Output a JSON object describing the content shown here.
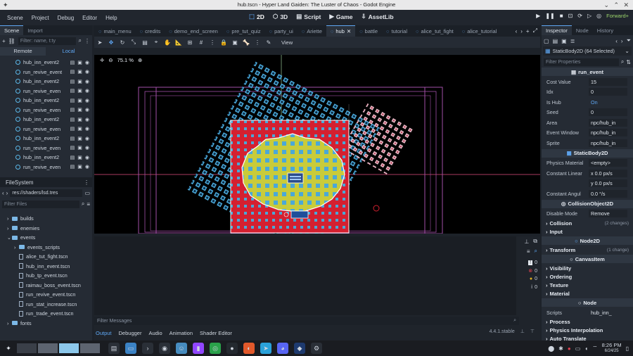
{
  "window": {
    "title": "hub.tscn - Hyper Land Gaiden: The Luster of Chaos - Godot Engine"
  },
  "menus": [
    "Scene",
    "Project",
    "Debug",
    "Editor",
    "Help"
  ],
  "workspaces": [
    {
      "label": "2D",
      "icon": "2d-icon",
      "active": true
    },
    {
      "label": "3D",
      "icon": "3d-icon"
    },
    {
      "label": "Script",
      "icon": "script-icon"
    },
    {
      "label": "Game",
      "icon": "game-icon"
    },
    {
      "label": "AssetLib",
      "icon": "assetlib-icon"
    }
  ],
  "renderer": "Forward+",
  "left_dock": {
    "tabs": [
      "Scene",
      "Import"
    ],
    "filter_placeholder": "Filter: name, t:ty",
    "remote_label": "Remote",
    "local_label": "Local",
    "nodes": [
      "hub_inn_event2",
      "run_revive_event",
      "hub_inn_event2",
      "run_revive_even",
      "hub_inn_event2",
      "run_revive_even",
      "hub_inn_event2",
      "run_revive_even",
      "hub_inn_event2",
      "run_revive_even",
      "hub_inn_event2",
      "run_revive_even"
    ]
  },
  "filesystem": {
    "title": "FileSystem",
    "path": "res://shaders/lsd.tres",
    "filter_placeholder": "Filter Files",
    "entries": [
      {
        "name": "builds",
        "type": "folder",
        "indent": 1
      },
      {
        "name": "enemies",
        "type": "folder",
        "indent": 1
      },
      {
        "name": "events",
        "type": "folder",
        "indent": 1,
        "open": true
      },
      {
        "name": "events_scripts",
        "type": "folder",
        "indent": 2
      },
      {
        "name": "alice_tut_fight.tscn",
        "type": "file",
        "indent": 2
      },
      {
        "name": "hub_inn_event.tscn",
        "type": "file",
        "indent": 2
      },
      {
        "name": "hub_tp_event.tscn",
        "type": "file",
        "indent": 2
      },
      {
        "name": "raimau_boss_event.tscn",
        "type": "file",
        "indent": 2
      },
      {
        "name": "run_revive_event.tscn",
        "type": "file",
        "indent": 2
      },
      {
        "name": "run_stat_increase.tscn",
        "type": "file",
        "indent": 2
      },
      {
        "name": "run_trade_event.tscn",
        "type": "file",
        "indent": 2
      },
      {
        "name": "fonts",
        "type": "folder",
        "indent": 1
      }
    ]
  },
  "scene_tabs": [
    "main_menu",
    "credits",
    "demo_end_screen",
    "pre_tut_quiz",
    "party_ui",
    "Ariette",
    "hub",
    "battle",
    "tutorial",
    "alice_tut_fight",
    "alice_tutorial"
  ],
  "active_scene_tab": "hub",
  "toolbar": {
    "view_label": "View"
  },
  "viewport": {
    "zoom": "75.1 %"
  },
  "bottom_panel": {
    "filter_placeholder": "Filter Messages",
    "tabs": [
      "Output",
      "Debugger",
      "Audio",
      "Animation",
      "Shader Editor"
    ],
    "version": "4.4.1.stable",
    "counts": [
      "0",
      "0",
      "0",
      "0"
    ]
  },
  "inspector": {
    "tabs": [
      "Inspector",
      "Node",
      "History"
    ],
    "object": "StaticBody2D (64 Selected)",
    "filter_placeholder": "Filter Properties",
    "script_section": "run_event",
    "props": [
      {
        "k": "Cost Value",
        "v": "15"
      },
      {
        "k": "Idx",
        "v": "0"
      },
      {
        "k": "Is Hub",
        "v": "On"
      },
      {
        "k": "Seed",
        "v": "0"
      },
      {
        "k": "Area",
        "v": "npc/hub_in"
      },
      {
        "k": "Event Window",
        "v": "npc/hub_in"
      },
      {
        "k": "Sprite",
        "v": "npc/hub_in"
      }
    ],
    "staticbody_section": "StaticBody2D",
    "staticbody_props": [
      {
        "k": "Physics Material",
        "v": "<empty>"
      },
      {
        "k": "Constant Linear",
        "v": "x 0.0 px/s"
      },
      {
        "k": "",
        "v": "y 0.0 px/s"
      },
      {
        "k": "Constant Angul",
        "v": "0.0 °/s"
      }
    ],
    "collision_section": "CollisionObject2D",
    "disable_mode": {
      "k": "Disable Mode",
      "v": "Remove"
    },
    "groups1": [
      {
        "label": "Collision",
        "note": "(2 changes)"
      },
      {
        "label": "Input",
        "note": ""
      }
    ],
    "node2d_section": "Node2D",
    "transform": {
      "label": "Transform",
      "note": "(1 change)"
    },
    "canvasitem_section": "CanvasItem",
    "groups2": [
      "Visibility",
      "Ordering",
      "Texture",
      "Material"
    ],
    "node_section": "Node",
    "scripts": {
      "k": "Scripts",
      "v": "hub_inn_"
    },
    "groups3": [
      "Process",
      "Physics Interpolation",
      "Auto Translate"
    ]
  },
  "taskbar": {
    "time": "8:26 PM",
    "date": "6/24/25"
  }
}
